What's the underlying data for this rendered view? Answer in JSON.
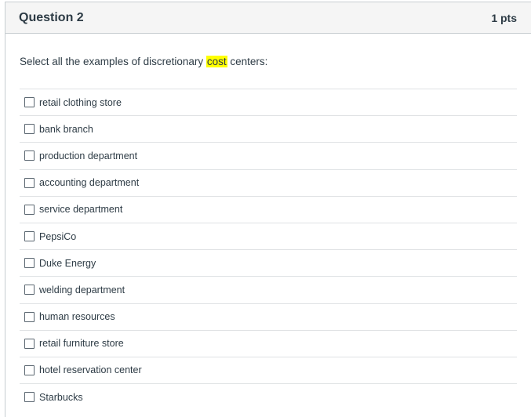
{
  "question": {
    "title": "Question 2",
    "points": "1 pts",
    "text_before": "Select all the examples of discretionary ",
    "text_highlight": "cost",
    "text_after": " centers:"
  },
  "answers": [
    {
      "label": "retail clothing store",
      "checked": false
    },
    {
      "label": "bank branch",
      "checked": false
    },
    {
      "label": "production department",
      "checked": false
    },
    {
      "label": "accounting department",
      "checked": false
    },
    {
      "label": "service department",
      "checked": false
    },
    {
      "label": "PepsiCo",
      "checked": false
    },
    {
      "label": "Duke Energy",
      "checked": false
    },
    {
      "label": "welding department",
      "checked": false
    },
    {
      "label": "human resources",
      "checked": false
    },
    {
      "label": "retail furniture store",
      "checked": false
    },
    {
      "label": "hotel reservation center",
      "checked": false
    },
    {
      "label": "Starbucks",
      "checked": false
    }
  ]
}
